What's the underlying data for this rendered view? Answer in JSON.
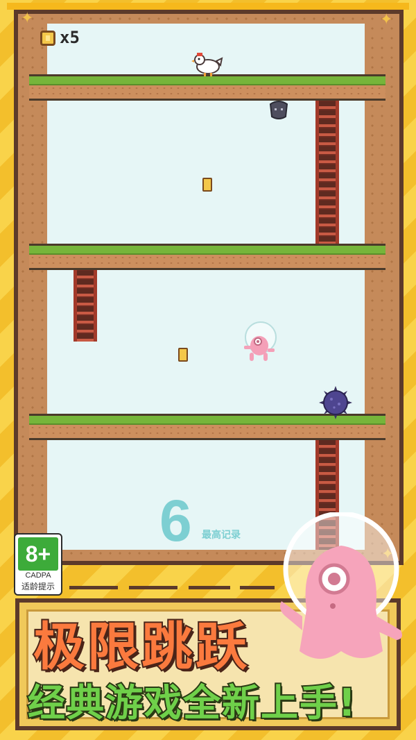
{
  "hud": {
    "coin_icon": "coin-icon",
    "coins": "x5"
  },
  "record": {
    "score": "6",
    "label": "最高记录"
  },
  "age_rating": {
    "age": "8+",
    "org": "CADPA",
    "tip": "适龄提示"
  },
  "promo": {
    "title": "极限跳跃",
    "subtitle": "经典游戏全新上手!"
  },
  "colors": {
    "background": "#f7c93a",
    "sky": "#e6f6f6",
    "grass": "#76b53a",
    "dirt": "#cd8f5e",
    "ladder": "#a23a2a",
    "title_orange": "#fb7a3e",
    "subtitle_green": "#6fd04a",
    "record_cyan": "#7dcfd2",
    "hero_pink": "#f4a0b8"
  },
  "sprites": [
    "chicken",
    "bat",
    "spike-ball",
    "pink-astronaut",
    "coin",
    "ladder"
  ]
}
